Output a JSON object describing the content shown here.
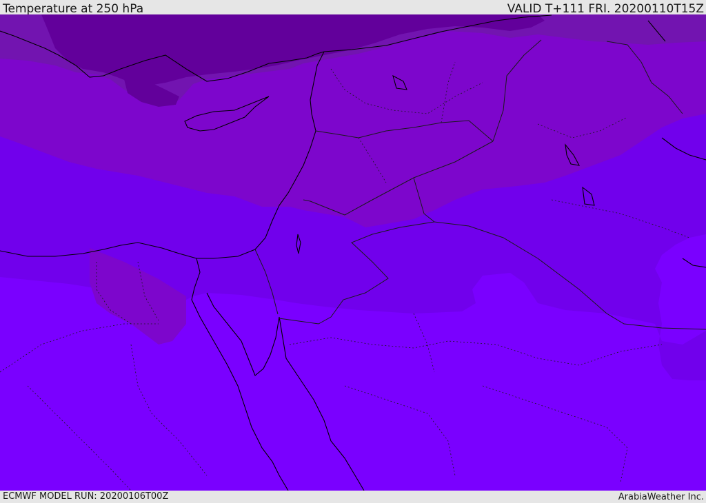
{
  "header": {
    "title": "Temperature at 250 hPa",
    "valid": "VALID T+111 FRI. 20200110T15Z"
  },
  "footer": {
    "model_run": "ECMWF MODEL RUN: 20200106T00Z",
    "credit": "ArabiaWeather Inc."
  },
  "map": {
    "field": "temperature",
    "level": "250 hPa",
    "colors": {
      "coldest": "#62009b",
      "band_2": "#7214b0",
      "band_3": "#7d06cc",
      "band_4": "#7100ec",
      "warmest": "#7a00ff",
      "coastline": "#000000",
      "border": "#1a1a1a"
    }
  }
}
